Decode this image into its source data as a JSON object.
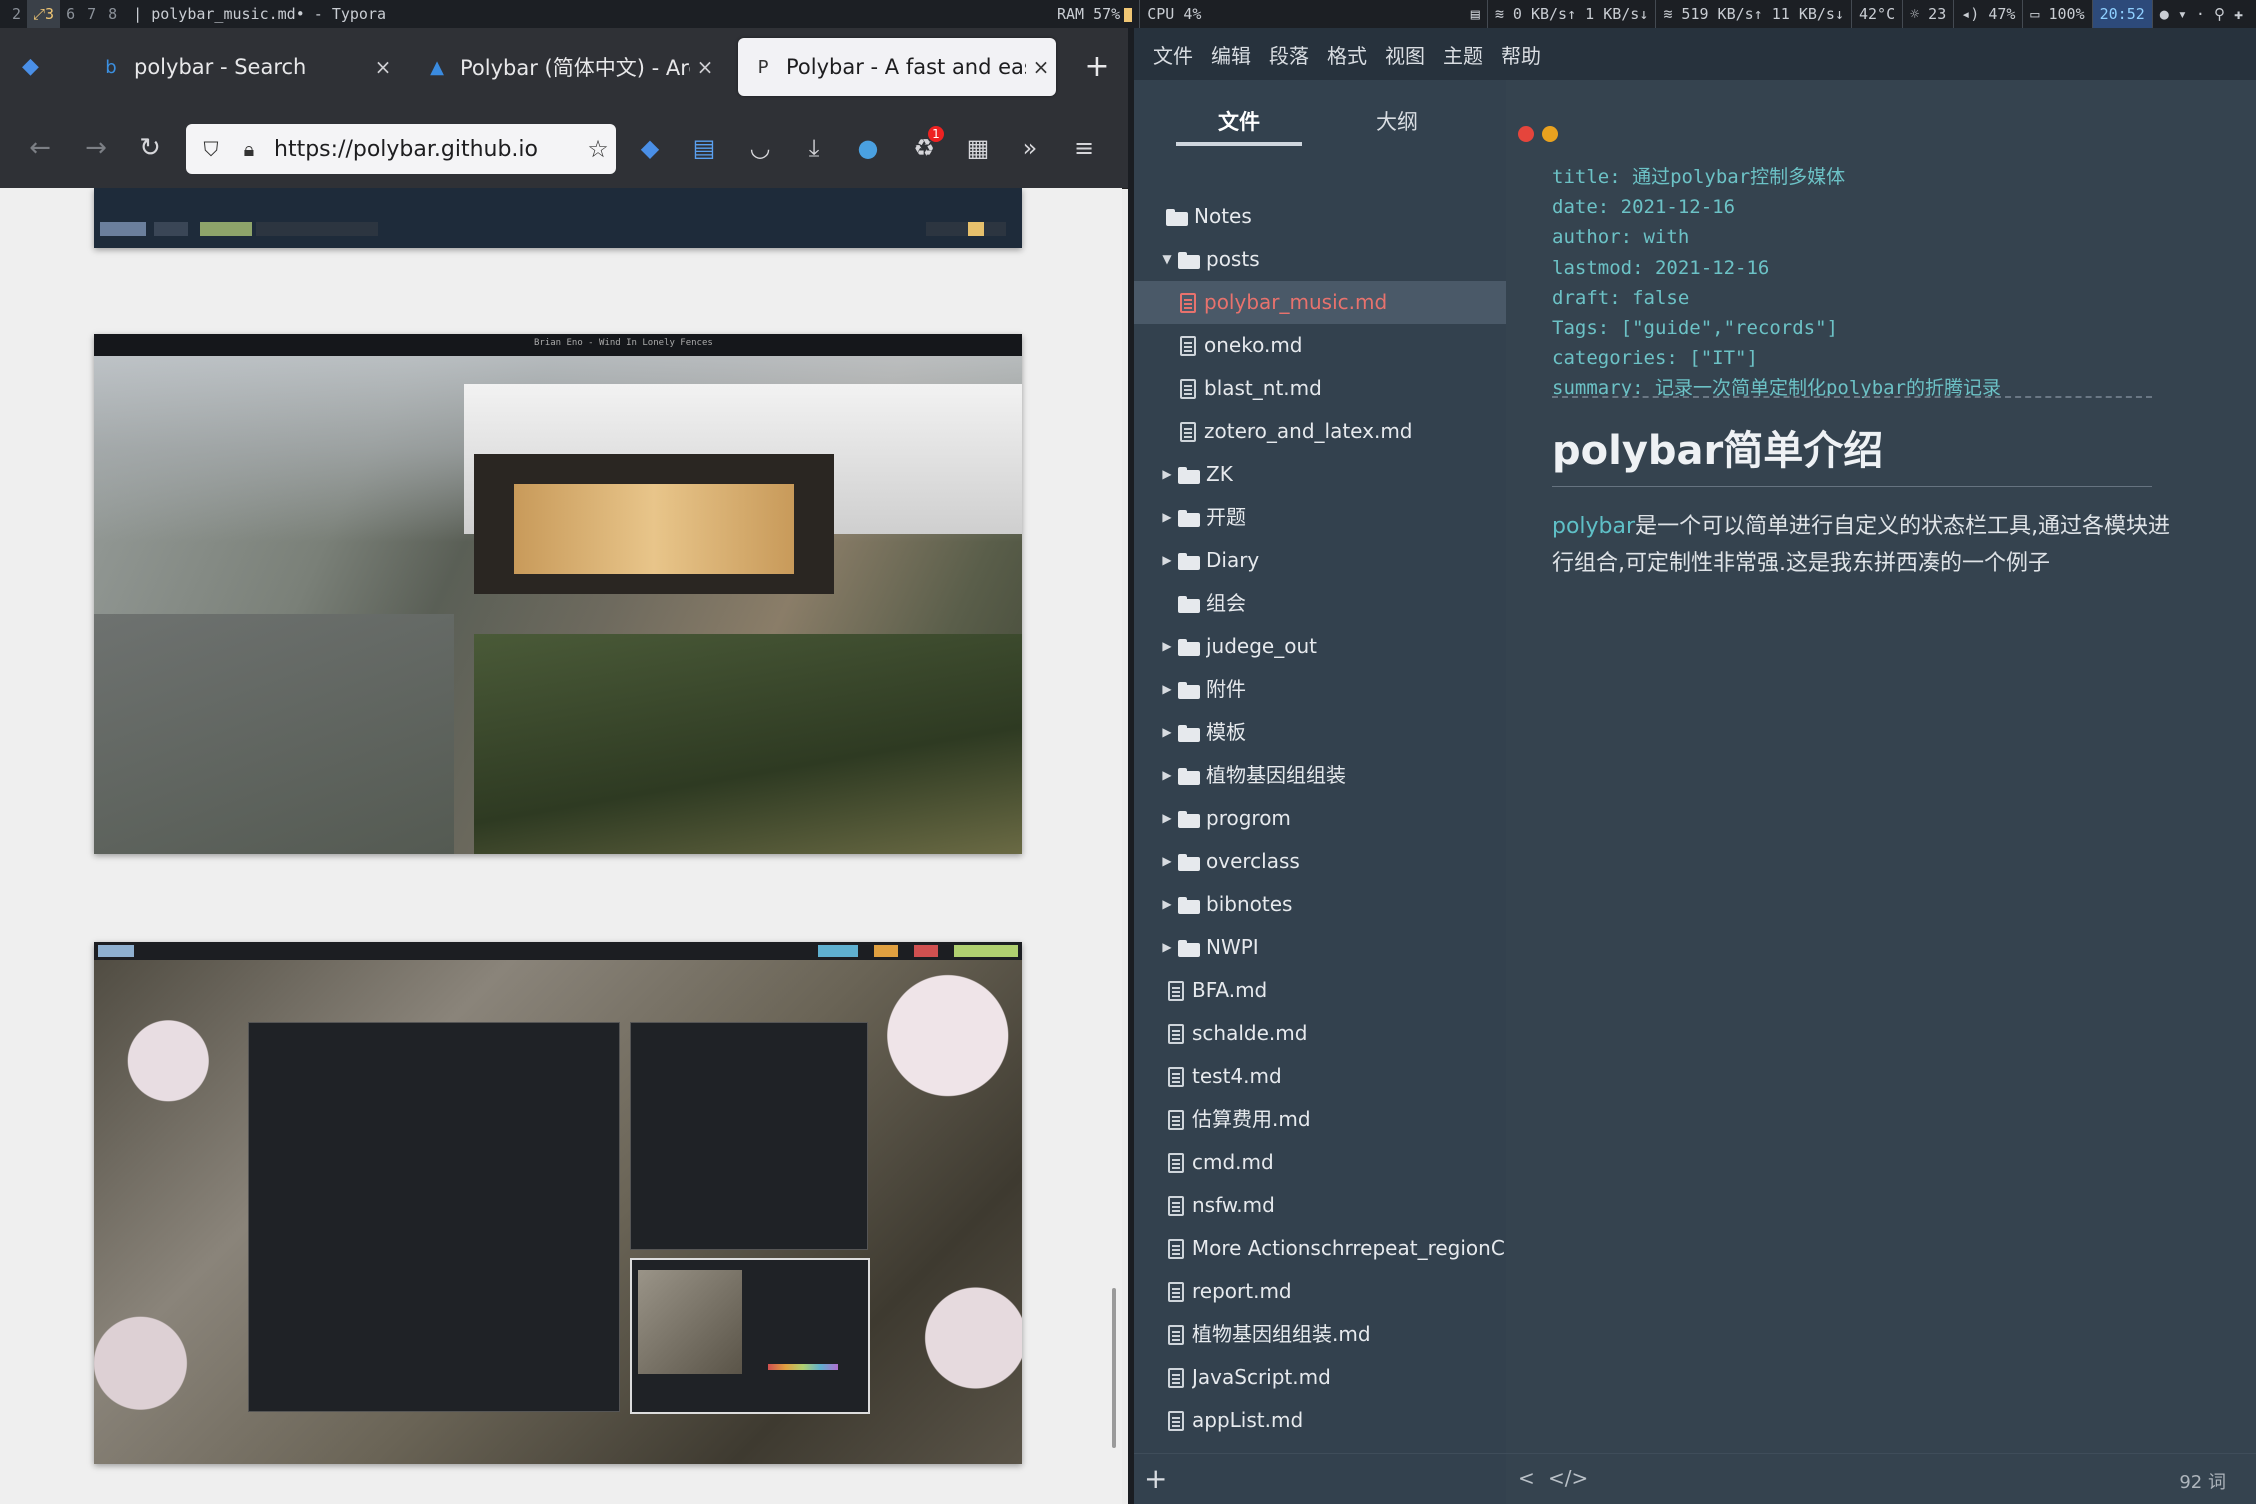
{
  "polybar": {
    "workspaces": [
      {
        "label": "2",
        "active": false
      },
      {
        "label": "⤢3",
        "active": true
      },
      {
        "label": "6",
        "active": false
      },
      {
        "label": "7",
        "active": false
      },
      {
        "label": "8",
        "active": false
      }
    ],
    "window_title": "| polybar_music.md• - Typora",
    "ram": "RAM 57%",
    "cpu": "CPU 4%",
    "net1": "0 KB/s↑ 1 KB/s↓",
    "net2": "519 KB/s↑ 11 KB/s↓",
    "temp": "42°C",
    "brightness": "☼ 23",
    "volume": "47%",
    "battery": "100%",
    "time": "20:52"
  },
  "browser": {
    "tabs": [
      {
        "title": "polybar - Search",
        "active": false
      },
      {
        "title": "Polybar (简体中文) - ArchWiki",
        "active": false
      },
      {
        "title": "Polybar - A fast and easy-to-use tool",
        "active": true
      }
    ],
    "new_tab": "+",
    "url": "https://polybar.github.io",
    "extension_badge": "1",
    "screenshot_bar_text": "Brian Eno - Wind In Lonely Fences"
  },
  "typora": {
    "menu": [
      "文件",
      "编辑",
      "段落",
      "格式",
      "视图",
      "主题",
      "帮助"
    ],
    "sidebar_tabs": [
      "文件",
      "大纲"
    ],
    "tree": [
      {
        "label": "Notes",
        "kind": "folder",
        "level": 0,
        "caret": ""
      },
      {
        "label": "posts",
        "kind": "folder",
        "level": 1,
        "caret": "▼"
      },
      {
        "label": "polybar_music.md",
        "kind": "file",
        "level": 2,
        "selected": true
      },
      {
        "label": "oneko.md",
        "kind": "file",
        "level": 2
      },
      {
        "label": "blast_nt.md",
        "kind": "file",
        "level": 2
      },
      {
        "label": "zotero_and_latex.md",
        "kind": "file",
        "level": 2
      },
      {
        "label": "ZK",
        "kind": "folder",
        "level": 1,
        "caret": "▶"
      },
      {
        "label": "开题",
        "kind": "folder",
        "level": 1,
        "caret": "▶"
      },
      {
        "label": "Diary",
        "kind": "folder",
        "level": 1,
        "caret": "▶"
      },
      {
        "label": "组会",
        "kind": "folder",
        "level": 1,
        "caret": ""
      },
      {
        "label": "judege_out",
        "kind": "folder",
        "level": 1,
        "caret": "▶"
      },
      {
        "label": "附件",
        "kind": "folder",
        "level": 1,
        "caret": "▶"
      },
      {
        "label": "模板",
        "kind": "folder",
        "level": 1,
        "caret": "▶"
      },
      {
        "label": "植物基因组组装",
        "kind": "folder",
        "level": 1,
        "caret": "▶"
      },
      {
        "label": "progrom",
        "kind": "folder",
        "level": 1,
        "caret": "▶"
      },
      {
        "label": "overclass",
        "kind": "folder",
        "level": 1,
        "caret": "▶"
      },
      {
        "label": "bibnotes",
        "kind": "folder",
        "level": 1,
        "caret": "▶"
      },
      {
        "label": "NWPI",
        "kind": "folder",
        "level": 1,
        "caret": "▶"
      },
      {
        "label": "BFA.md",
        "kind": "file",
        "level": 1
      },
      {
        "label": "schalde.md",
        "kind": "file",
        "level": 1
      },
      {
        "label": "test4.md",
        "kind": "file",
        "level": 1
      },
      {
        "label": "估算费用.md",
        "kind": "file",
        "level": 1
      },
      {
        "label": "cmd.md",
        "kind": "file",
        "level": 1
      },
      {
        "label": "nsfw.md",
        "kind": "file",
        "level": 1
      },
      {
        "label": "More Actionschrrepeat_regionCl",
        "kind": "file",
        "level": 1
      },
      {
        "label": "report.md",
        "kind": "file",
        "level": 1
      },
      {
        "label": "植物基因组组装.md",
        "kind": "file",
        "level": 1
      },
      {
        "label": "JavaScript.md",
        "kind": "file",
        "level": 1
      },
      {
        "label": "appList.md",
        "kind": "file",
        "level": 1
      }
    ],
    "frontmatter": [
      "title: 通过polybar控制多媒体",
      "date: 2021-12-16",
      "author: with",
      "lastmod: 2021-12-16",
      "draft: false",
      "Tags: [\"guide\",\"records\"]",
      "categories: [\"IT\"]",
      "summary: 记录一次简单定制化polybar的折腾记录"
    ],
    "heading": "polybar简单介绍",
    "para_link": "polybar",
    "para_rest": "是一个可以简单进行自定义的状态栏工具,通过各模块进行组合,可定制性非常强.这是我东拼西凑的一个例子",
    "word_count": "92 词",
    "footer_prev": "<",
    "footer_source": "</>",
    "add_label": "+"
  }
}
